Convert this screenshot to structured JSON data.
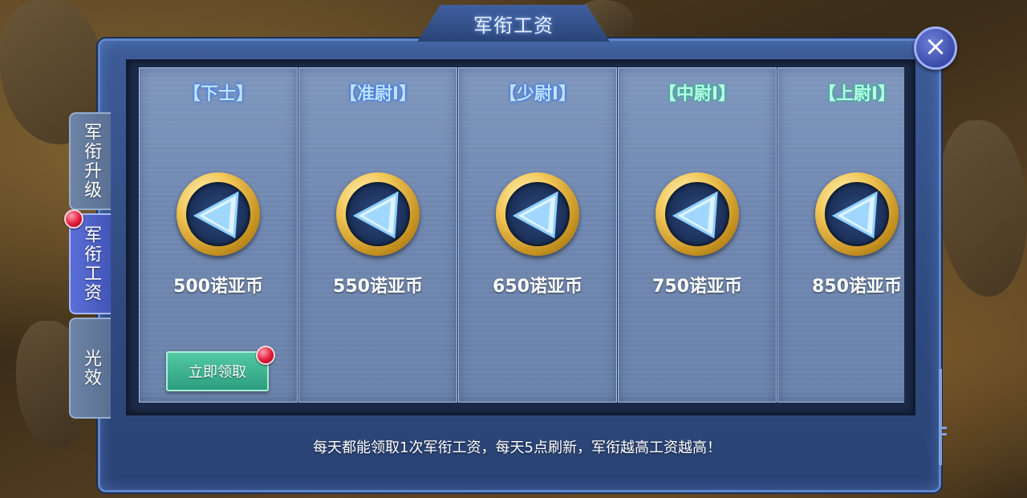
{
  "window": {
    "title": "军衔工资"
  },
  "side_tabs": [
    {
      "label": "军衔升级",
      "active": false,
      "has_notification": false
    },
    {
      "label": "军衔工资",
      "active": true,
      "has_notification": true
    },
    {
      "label": "光效",
      "active": false,
      "has_notification": false
    }
  ],
  "cards": [
    {
      "rank": "【下士】",
      "rank_color": "blue",
      "reward": "500诺亚币",
      "claim_label": "立即领取",
      "claimable": true
    },
    {
      "rank": "【准尉Ⅰ】",
      "rank_color": "blue",
      "reward": "550诺亚币",
      "claimable": false
    },
    {
      "rank": "【少尉Ⅰ】",
      "rank_color": "blue",
      "reward": "650诺亚币",
      "claimable": false
    },
    {
      "rank": "【中尉Ⅰ】",
      "rank_color": "green",
      "reward": "750诺亚币",
      "claimable": false
    },
    {
      "rank": "【上尉Ⅰ】",
      "rank_color": "green",
      "reward": "850诺亚币",
      "claimable": false
    }
  ],
  "footer": {
    "note": "每天都能领取1次军衔工资，每天5点刷新，军衔越高工资越高！"
  },
  "close_icon": "close-icon",
  "coin_icon": "noah-coin-icon",
  "colors": {
    "accent": "#3d5c98",
    "claim_button": "#2d9d7e",
    "notification": "#e21b3a"
  }
}
